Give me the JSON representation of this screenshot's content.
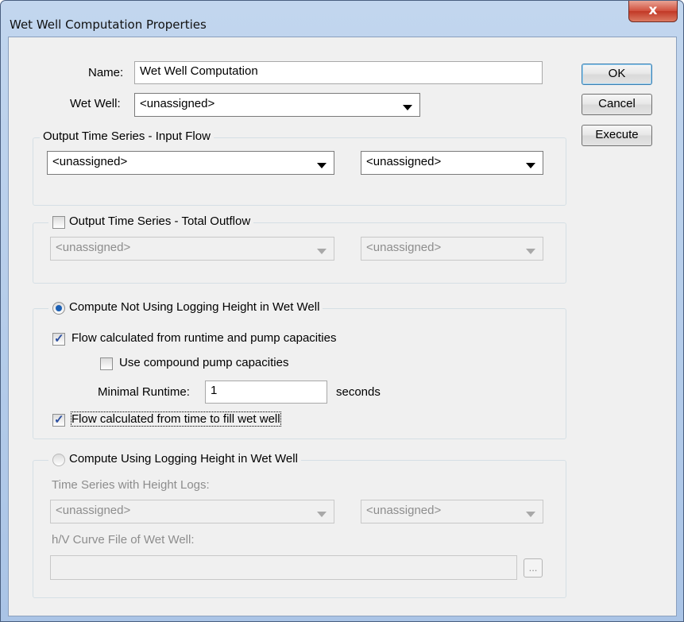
{
  "window": {
    "title": "Wet Well Computation Properties",
    "close_symbol": "x"
  },
  "form": {
    "name_label": "Name:",
    "name_value": "Wet Well Computation",
    "wetwell_label": "Wet Well:",
    "wetwell_value": "<unassigned>"
  },
  "buttons": {
    "ok": "OK",
    "cancel": "Cancel",
    "execute": "Execute"
  },
  "input_flow": {
    "title": "Output Time Series - Input Flow",
    "combo1": "<unassigned>",
    "combo2": "<unassigned>"
  },
  "total_outflow": {
    "title": "Output Time Series - Total Outflow",
    "checked": false,
    "combo1": "<unassigned>",
    "combo2": "<unassigned>"
  },
  "not_logging": {
    "title": "Compute Not Using Logging Height in Wet Well",
    "selected": true,
    "flow_runtime_label": "Flow calculated from runtime and pump capacities",
    "flow_runtime_checked": true,
    "compound_label": "Use compound pump capacities",
    "compound_checked": false,
    "min_runtime_label": "Minimal Runtime:",
    "min_runtime_value": "1",
    "min_runtime_unit": "seconds",
    "fill_label": "Flow calculated from time to fill wet well",
    "fill_checked": true
  },
  "logging": {
    "title": "Compute Using Logging Height in Wet Well",
    "selected": false,
    "height_logs_label": "Time Series with Height Logs:",
    "combo1": "<unassigned>",
    "combo2": "<unassigned>",
    "curve_file_label": "h/V Curve File of Wet Well:",
    "curve_file_value": "",
    "browse_label": "..."
  }
}
